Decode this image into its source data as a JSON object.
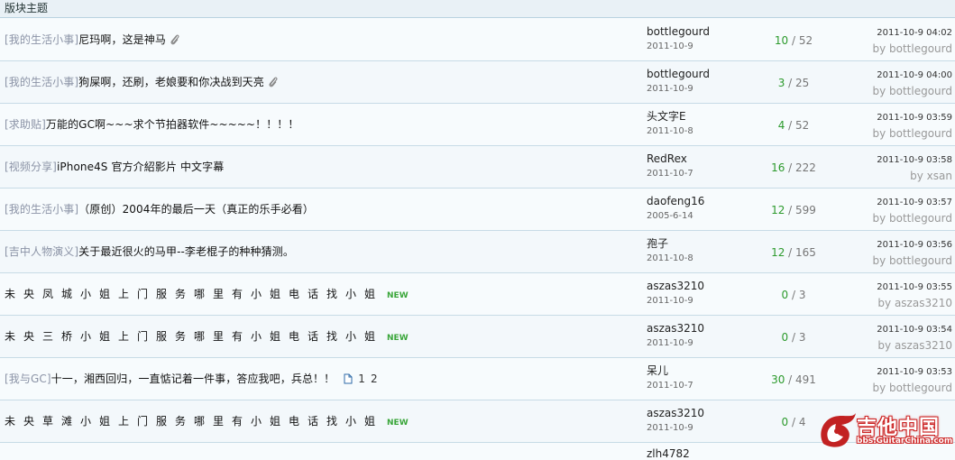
{
  "section_header": "版块主题",
  "colors": {
    "replies": "#2c9a2c",
    "new_badge": "#3aa63a",
    "category": "#8b93a6",
    "logo_red": "#c22222"
  },
  "threads": [
    {
      "category": "[我的生活小事]",
      "title": "尼玛啊，这是神马",
      "attachment": true,
      "is_new": false,
      "pages": [],
      "author": "bottlegourd",
      "post_date": "2011-10-9",
      "replies": "10",
      "views": "52",
      "last_time": "2011-10-9 04:02",
      "last_by": "by bottlegourd"
    },
    {
      "category": "[我的生活小事]",
      "title": "狗屎啊，还刷，老娘要和你决战到天亮",
      "attachment": true,
      "is_new": false,
      "pages": [],
      "author": "bottlegourd",
      "post_date": "2011-10-9",
      "replies": "3",
      "views": "25",
      "last_time": "2011-10-9 04:00",
      "last_by": "by bottlegourd"
    },
    {
      "category": "[求助贴]",
      "title": "万能的GC啊~~~求个节拍器软件~~~~~！！！！",
      "attachment": false,
      "is_new": false,
      "pages": [],
      "author": "头文字E",
      "post_date": "2011-10-8",
      "replies": "4",
      "views": "52",
      "last_time": "2011-10-9 03:59",
      "last_by": "by bottlegourd"
    },
    {
      "category": "[视频分享]",
      "title": "iPhone4S 官方介紹影片  中文字幕",
      "attachment": false,
      "is_new": false,
      "pages": [],
      "author": "RedRex",
      "post_date": "2011-10-7",
      "replies": "16",
      "views": "222",
      "last_time": "2011-10-9 03:58",
      "last_by": "by xsan"
    },
    {
      "category": "[我的生活小事]",
      "title": "（原创）2004年的最后一天（真正的乐手必看）",
      "attachment": false,
      "is_new": false,
      "pages": [],
      "author": "daofeng16",
      "post_date": "2005-6-14",
      "replies": "12",
      "views": "599",
      "last_time": "2011-10-9 03:57",
      "last_by": "by bottlegourd"
    },
    {
      "category": "[吉中人物演义]",
      "title": "关于最近很火的马甲--李老棍子的种种猜测。",
      "attachment": false,
      "is_new": false,
      "pages": [],
      "author": "孢子",
      "post_date": "2011-10-8",
      "replies": "12",
      "views": "165",
      "last_time": "2011-10-9 03:56",
      "last_by": "by bottlegourd"
    },
    {
      "category": "",
      "title": "未央凤城小姐上门服务哪里有小姐电话找小姐",
      "spaced": true,
      "attachment": false,
      "is_new": true,
      "new_label": "NEW",
      "pages": [],
      "author": "aszas3210",
      "post_date": "2011-10-9",
      "replies": "0",
      "views": "3",
      "last_time": "2011-10-9 03:55",
      "last_by": "by aszas3210"
    },
    {
      "category": "",
      "title": "未央三桥小姐上门服务哪里有小姐电话找小姐",
      "spaced": true,
      "attachment": false,
      "is_new": true,
      "new_label": "NEW",
      "pages": [],
      "author": "aszas3210",
      "post_date": "2011-10-9",
      "replies": "0",
      "views": "3",
      "last_time": "2011-10-9 03:54",
      "last_by": "by aszas3210"
    },
    {
      "category": "[我与GC]",
      "title": "十一，湘西回归，一直惦记着一件事，答应我吧，兵总！！",
      "attachment": false,
      "is_new": false,
      "pages": [
        "1",
        "2"
      ],
      "author": "呆儿",
      "post_date": "2011-10-7",
      "replies": "30",
      "views": "491",
      "last_time": "2011-10-9 03:53",
      "last_by": "by bottlegourd"
    },
    {
      "category": "",
      "title": "未央草滩小姐上门服务哪里有小姐电话找小姐",
      "spaced": true,
      "attachment": false,
      "is_new": true,
      "new_label": "NEW",
      "pages": [],
      "author": "aszas3210",
      "post_date": "2011-10-9",
      "replies": "0",
      "views": "4",
      "last_time": "",
      "last_by": ""
    }
  ],
  "partial_next_author": "zlh4782",
  "logo": {
    "name": "吉他中国",
    "url": "bbs.GuitarChina.com"
  }
}
